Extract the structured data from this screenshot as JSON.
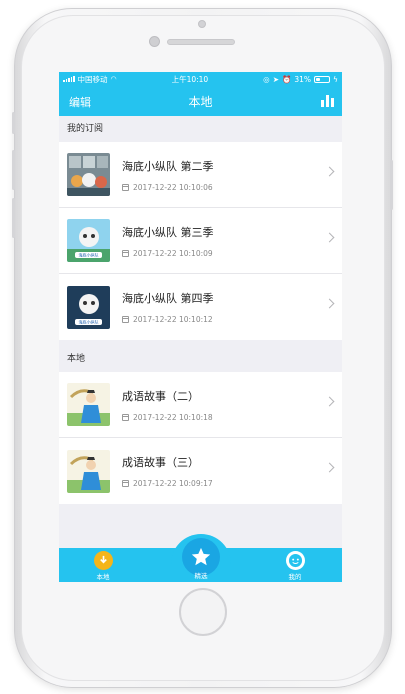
{
  "status_bar": {
    "carrier": "中国移动",
    "time": "上午10:10",
    "battery": "31%",
    "battery_level": 0.31
  },
  "nav": {
    "left_label": "编辑",
    "title": "本地",
    "right_icon": "bar-chart-icon"
  },
  "sections": [
    {
      "header": "我的订阅",
      "items": [
        {
          "title": "海底小纵队 第二季",
          "time": "2017-12-22 10:10:06"
        },
        {
          "title": "海底小纵队 第三季",
          "time": "2017-12-22 10:10:09"
        },
        {
          "title": "海底小纵队 第四季",
          "time": "2017-12-22 10:10:12"
        }
      ]
    },
    {
      "header": "本地",
      "items": [
        {
          "title": "成语故事（二）",
          "time": "2017-12-22 10:10:18"
        },
        {
          "title": "成语故事（三）",
          "time": "2017-12-22 10:09:17"
        }
      ]
    }
  ],
  "tabs": [
    {
      "label": "本地",
      "icon": "download-icon"
    },
    {
      "label": "精选",
      "icon": "star-icon"
    },
    {
      "label": "我的",
      "icon": "face-icon"
    }
  ],
  "colors": {
    "primary": "#25c3ef",
    "accent_dark": "#1aa6e3",
    "tab_orange": "#f5b51a"
  },
  "thumb_captions": {
    "octonauts": "海底小纵队"
  }
}
